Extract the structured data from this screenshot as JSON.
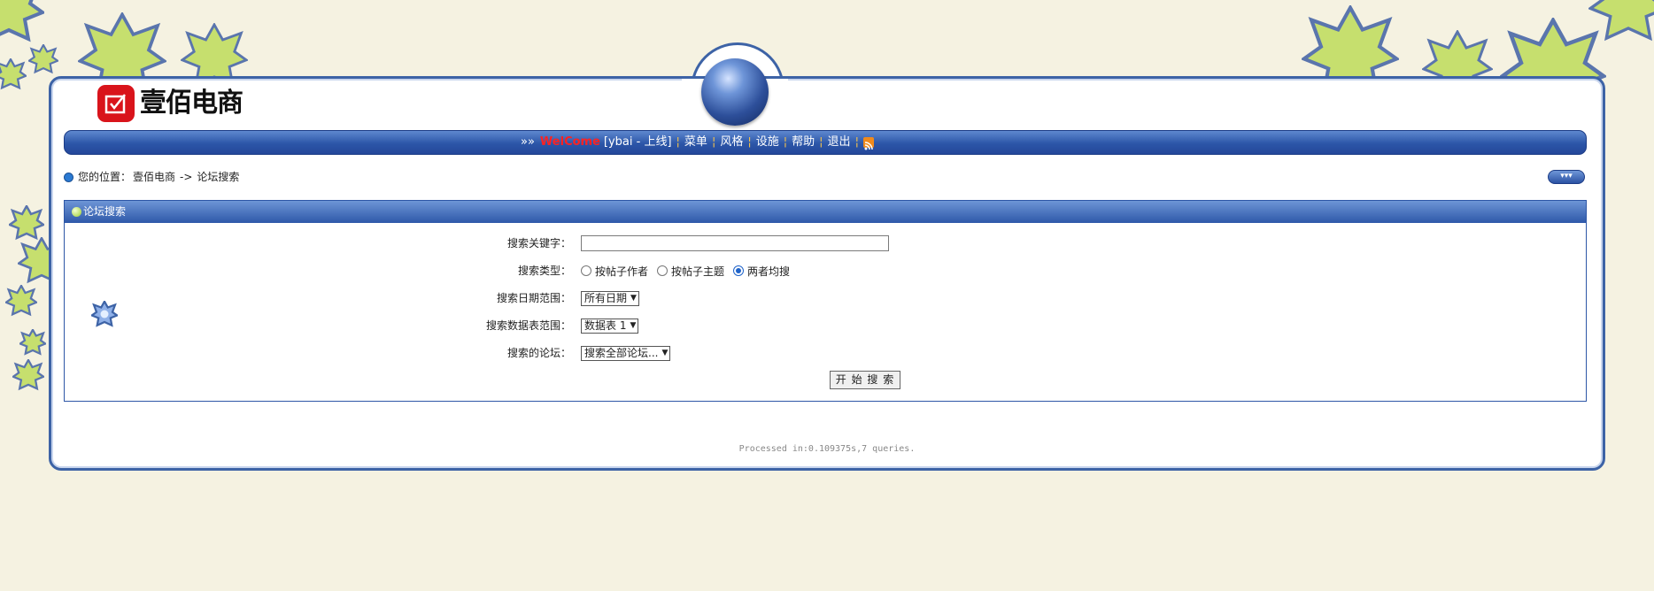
{
  "logo": {
    "alt_text": "壹佰电商"
  },
  "nav": {
    "prefix": "»»",
    "welcome": "WelCome",
    "user_status": "[ybai - 上线]",
    "items": [
      "菜单",
      "风格",
      "设施",
      "帮助",
      "退出"
    ],
    "rss_icon": "rss-icon"
  },
  "breadcrumb": {
    "label": "您的位置：",
    "site": "壹佰电商",
    "arrow": "->",
    "current": "论坛搜索"
  },
  "collapse_button": {
    "label": "▾▾▾"
  },
  "panel": {
    "title": "论坛搜索",
    "keyword_label": "搜索关键字：",
    "keyword_value": "",
    "type_label": "搜索类型：",
    "type_options": [
      "按帖子作者",
      "按帖子主题",
      "两者均搜"
    ],
    "type_selected": "两者均搜",
    "date_label": "搜索日期范围：",
    "date_value": "所有日期",
    "table_label": "搜索数据表范围：",
    "table_value": "数据表 1",
    "forum_label": "搜索的论坛：",
    "forum_value": "搜索全部论坛...",
    "submit_label": "开 始 搜 索"
  },
  "footer": {
    "processed": "Processed in:0.109375s,7 queries."
  },
  "colors": {
    "background": "#f5f2e1",
    "frame_blue": "#3d63a6",
    "welcome_red": "#ff2222",
    "star_green": "#b8d84a"
  }
}
